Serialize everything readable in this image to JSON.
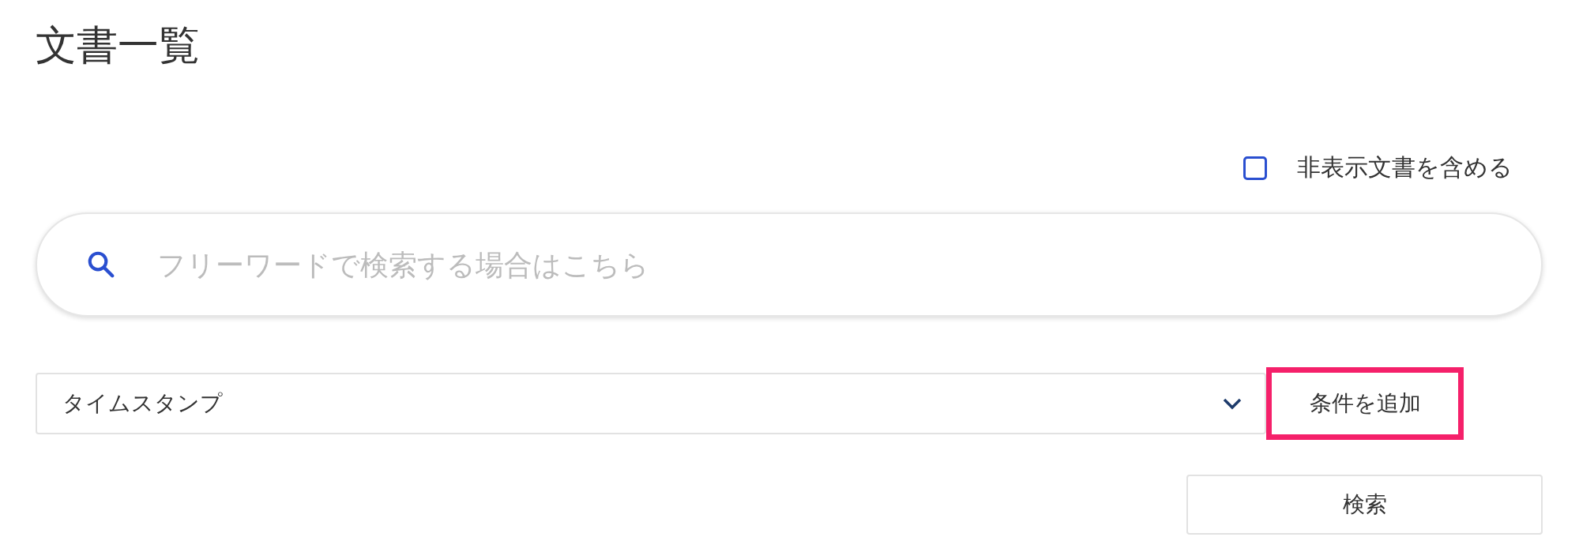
{
  "title": "文書一覧",
  "include_hidden": {
    "label": "非表示文書を含める",
    "checked": false
  },
  "search": {
    "placeholder": "フリーワードで検索する場合はこちら"
  },
  "condition_select": {
    "value": "タイムスタンプ"
  },
  "add_condition_button": {
    "label": "条件を追加",
    "highlighted": true
  },
  "search_button": {
    "label": "検索"
  }
}
